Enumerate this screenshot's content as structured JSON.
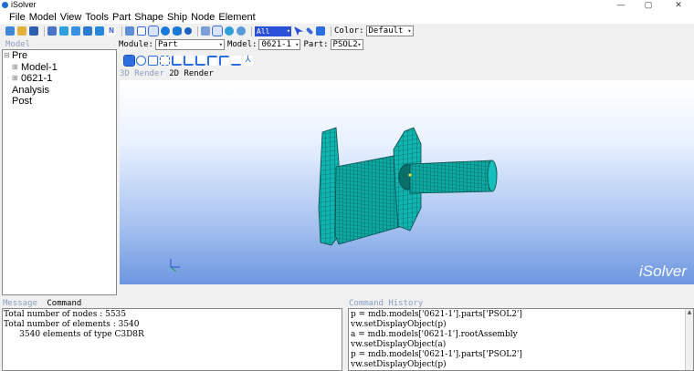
{
  "window": {
    "title": "iSolver",
    "controls": [
      "—",
      "▢",
      "✕"
    ]
  },
  "menu": [
    "File",
    "Model",
    "View",
    "Tools",
    "Part",
    "Shape",
    "Ship",
    "Node",
    "Element"
  ],
  "toolbar": {
    "selection_filter": "All",
    "color_label": "Color:",
    "color_value": "Default"
  },
  "model_panel": {
    "tab_label": "Model",
    "tree": [
      {
        "label": "Pre",
        "expander": "⊟",
        "level": 0
      },
      {
        "label": "Model-1",
        "expander": "⊞",
        "level": 1
      },
      {
        "label": "0621-1",
        "expander": "⊞",
        "level": 1
      },
      {
        "label": "Analysis",
        "expander": "",
        "level": 0
      },
      {
        "label": "Post",
        "expander": "",
        "level": 0
      }
    ]
  },
  "context_bar": {
    "module_label": "Module:",
    "module_value": "Part",
    "model_label": "Model:",
    "model_value": "0621-1",
    "part_label": "Part:",
    "part_value": "PSOL2"
  },
  "render_tabs": [
    "3D Render",
    "2D Render"
  ],
  "viewport": {
    "brand": "iSolver"
  },
  "message_panel": {
    "tabs": [
      "Message",
      "Command"
    ],
    "lines": [
      "Total number of nodes : 5535",
      "Total number of elements : 3540",
      "      3540 elements of type C3D8R"
    ]
  },
  "history_panel": {
    "tab_label": "Command History",
    "lines": [
      "p = mdb.models['0621-1'].parts['PSOL2']",
      "vw.setDisplayObject(p)",
      "a = mdb.models['0621-1'].rootAssembly",
      "vw.setDisplayObject(a)",
      "p = mdb.models['0621-1'].parts['PSOL2']",
      "vw.setDisplayObject(p)"
    ]
  },
  "colors": {
    "mesh_fill": "#10b5b0",
    "mesh_line": "#064a48",
    "accent": "#2a4fd8"
  }
}
